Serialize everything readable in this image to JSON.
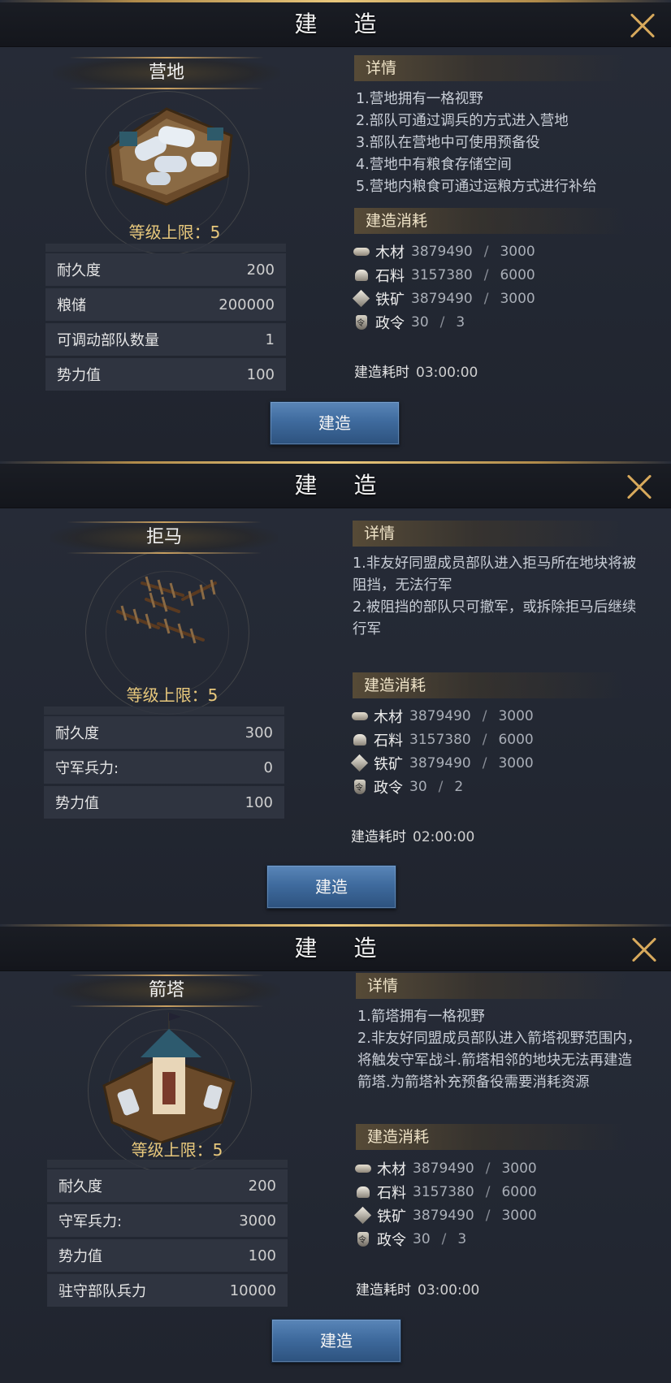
{
  "panels": [
    {
      "title": "建 造",
      "name": "营地",
      "level": "等级上限：5",
      "stats": [
        {
          "label": "耐久度",
          "value": "200"
        },
        {
          "label": "粮储",
          "value": "200000"
        },
        {
          "label": "可调动部队数量",
          "value": "1"
        },
        {
          "label": "势力值",
          "value": "100"
        }
      ],
      "details_title": "详情",
      "details": [
        "1.营地拥有一格视野",
        "2.部队可通过调兵的方式进入营地",
        "3.部队在营地中可使用预备役",
        "4.营地中有粮食存储空间",
        "5.营地内粮食可通过运粮方式进行补给"
      ],
      "cost_title": "建造消耗",
      "costs": [
        {
          "icon": "wood-icon",
          "name": "木材",
          "have": "3879490",
          "need": "3000"
        },
        {
          "icon": "stone-icon",
          "name": "石料",
          "have": "3157380",
          "need": "6000"
        },
        {
          "icon": "iron-icon",
          "name": "铁矿",
          "have": "3879490",
          "need": "3000"
        },
        {
          "icon": "order-icon",
          "name": "政令",
          "have": "30",
          "need": "3"
        }
      ],
      "time_label": "建造耗时",
      "time_value": "03:00:00",
      "button": "建造"
    },
    {
      "title": "建 造",
      "name": "拒马",
      "level": "等级上限：5",
      "stats": [
        {
          "label": "耐久度",
          "value": "300"
        },
        {
          "label": "守军兵力:",
          "value": "0"
        },
        {
          "label": "势力值",
          "value": "100"
        }
      ],
      "details_title": "详情",
      "details": [
        "1.非友好同盟成员部队进入拒马所在地块将被阻挡，无法行军",
        "2.被阻挡的部队只可撤军，或拆除拒马后继续行军"
      ],
      "cost_title": "建造消耗",
      "costs": [
        {
          "icon": "wood-icon",
          "name": "木材",
          "have": "3879490",
          "need": "3000"
        },
        {
          "icon": "stone-icon",
          "name": "石料",
          "have": "3157380",
          "need": "6000"
        },
        {
          "icon": "iron-icon",
          "name": "铁矿",
          "have": "3879490",
          "need": "3000"
        },
        {
          "icon": "order-icon",
          "name": "政令",
          "have": "30",
          "need": "2"
        }
      ],
      "time_label": "建造耗时",
      "time_value": "02:00:00",
      "button": "建造"
    },
    {
      "title": "建 造",
      "name": "箭塔",
      "level": "等级上限：5",
      "stats": [
        {
          "label": "耐久度",
          "value": "200"
        },
        {
          "label": "守军兵力:",
          "value": "3000"
        },
        {
          "label": "势力值",
          "value": "100"
        },
        {
          "label": "驻守部队兵力",
          "value": "10000"
        }
      ],
      "details_title": "详情",
      "details": [
        "1.箭塔拥有一格视野",
        "2.非友好同盟成员部队进入箭塔视野范围内，将触发守军战斗.箭塔相邻的地块无法再建造箭塔.为箭塔补充预备役需要消耗资源"
      ],
      "cost_title": "建造消耗",
      "costs": [
        {
          "icon": "wood-icon",
          "name": "木材",
          "have": "3879490",
          "need": "3000"
        },
        {
          "icon": "stone-icon",
          "name": "石料",
          "have": "3157380",
          "need": "6000"
        },
        {
          "icon": "iron-icon",
          "name": "铁矿",
          "have": "3879490",
          "need": "3000"
        },
        {
          "icon": "order-icon",
          "name": "政令",
          "have": "30",
          "need": "3"
        }
      ],
      "time_label": "建造耗时",
      "time_value": "03:00:00",
      "button": "建造"
    }
  ]
}
